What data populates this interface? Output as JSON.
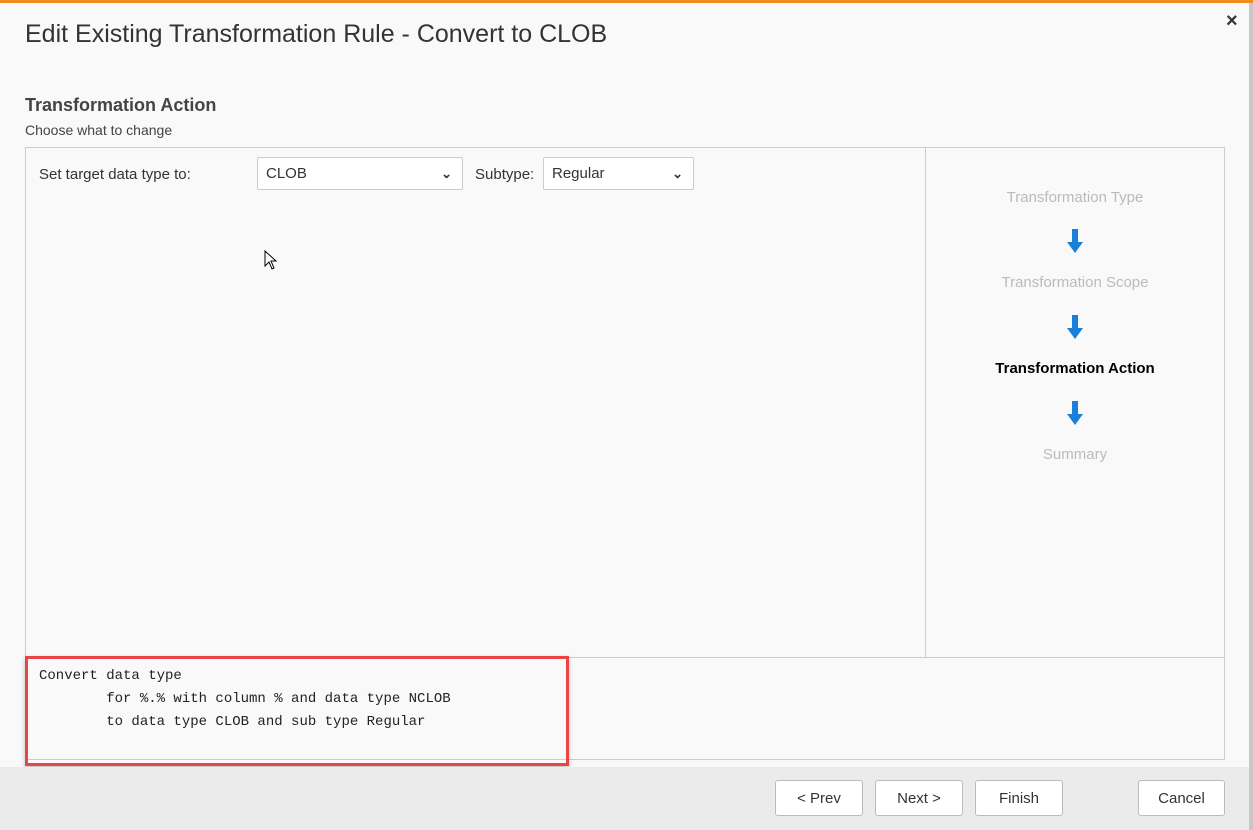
{
  "dialog": {
    "title": "Edit Existing Transformation Rule - Convert to CLOB",
    "close_label": "×"
  },
  "section": {
    "heading": "Transformation Action",
    "subheading": "Choose what to change"
  },
  "form": {
    "target_type_label": "Set target data type to:",
    "target_type_value": "CLOB",
    "subtype_label": "Subtype:",
    "subtype_value": "Regular"
  },
  "steps": [
    {
      "label": "Transformation Type",
      "state": "inactive"
    },
    {
      "label": "Transformation Scope",
      "state": "inactive"
    },
    {
      "label": "Transformation Action",
      "state": "active"
    },
    {
      "label": "Summary",
      "state": "inactive"
    }
  ],
  "summary_lines": [
    "Convert data type",
    "        for %.% with column % and data type NCLOB",
    "        to data type CLOB and sub type Regular"
  ],
  "buttons": {
    "prev": "< Prev",
    "next": "Next >",
    "finish": "Finish",
    "cancel": "Cancel"
  },
  "colors": {
    "accent": "#f28a24",
    "arrow": "#1a7fd9",
    "highlight": "#e94545"
  }
}
